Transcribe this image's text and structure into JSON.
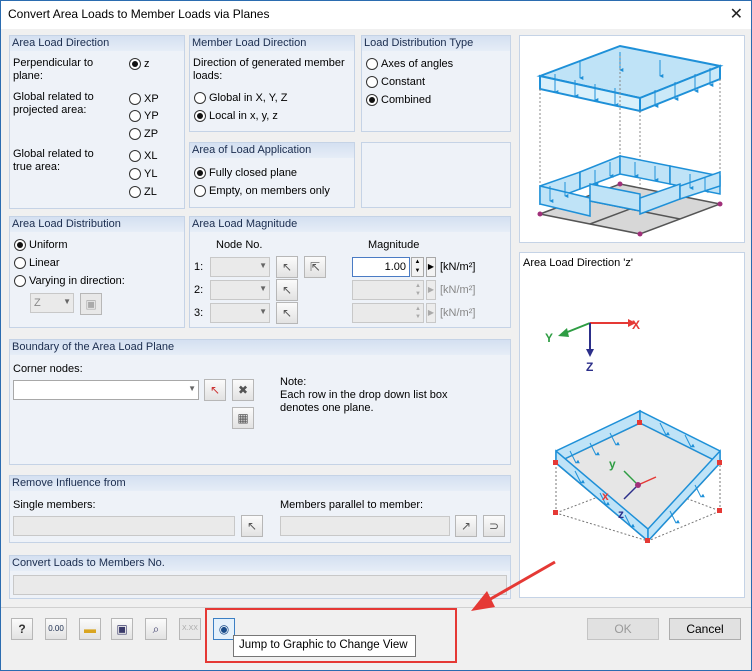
{
  "window": {
    "title": "Convert Area Loads to Member Loads via Planes",
    "close_label": "✕"
  },
  "area_load_direction": {
    "header": "Area Load Direction",
    "perp_label": "Perpendicular to plane:",
    "proj_label": "Global related to projected area:",
    "true_label": "Global related to true area:",
    "options": [
      "z",
      "XP",
      "YP",
      "ZP",
      "XL",
      "YL",
      "ZL"
    ],
    "selected": "z"
  },
  "member_load_direction": {
    "header": "Member Load Direction",
    "desc": "Direction of generated member loads:",
    "options": [
      "Global in X, Y, Z",
      "Local in x, y, z"
    ],
    "selected": "Local in x, y, z"
  },
  "load_distribution_type": {
    "header": "Load Distribution Type",
    "options": [
      "Axes of angles",
      "Constant",
      "Combined"
    ],
    "selected": "Combined"
  },
  "area_of_load_application": {
    "header": "Area of Load Application",
    "options": [
      "Fully closed plane",
      "Empty, on members only"
    ],
    "selected": "Fully closed plane"
  },
  "area_load_distribution": {
    "header": "Area Load Distribution",
    "options": [
      "Uniform",
      "Linear",
      "Varying in direction:"
    ],
    "selected": "Uniform",
    "direction_value": "Z"
  },
  "area_load_magnitude": {
    "header": "Area Load Magnitude",
    "col_node": "Node No.",
    "col_magnitude": "Magnitude",
    "rows": [
      {
        "label": "1:",
        "magnitude": "1.00",
        "unit": "[kN/m²]"
      },
      {
        "label": "2:",
        "magnitude": "",
        "unit": "[kN/m²]"
      },
      {
        "label": "3:",
        "magnitude": "",
        "unit": "[kN/m²]"
      }
    ]
  },
  "boundary": {
    "header": "Boundary of the Area Load Plane",
    "corner_label": "Corner nodes:",
    "corner_value": "",
    "note_title": "Note:",
    "note_text1": "Each row in the drop down list box",
    "note_text2": "denotes one plane."
  },
  "remove_influence": {
    "header": "Remove Influence from",
    "single_label": "Single members:",
    "parallel_label": "Members parallel to member:"
  },
  "convert_to_members": {
    "header": "Convert Loads to Members No."
  },
  "preview": {
    "direction_label": "Area Load Direction 'z'",
    "axes": {
      "x": "X",
      "y": "Y",
      "z": "Z"
    },
    "local_axes": {
      "x": "x",
      "y": "y",
      "z": "z"
    }
  },
  "footer": {
    "ok_label": "OK",
    "cancel_label": "Cancel",
    "calc_icon_text": "0.00",
    "xxx_icon_text": "X.XX",
    "tooltip": "Jump to Graphic to Change View"
  },
  "colors": {
    "accent": "#1e90d8",
    "highlight": "#e53935",
    "panel_header": "#d4e0f1"
  }
}
